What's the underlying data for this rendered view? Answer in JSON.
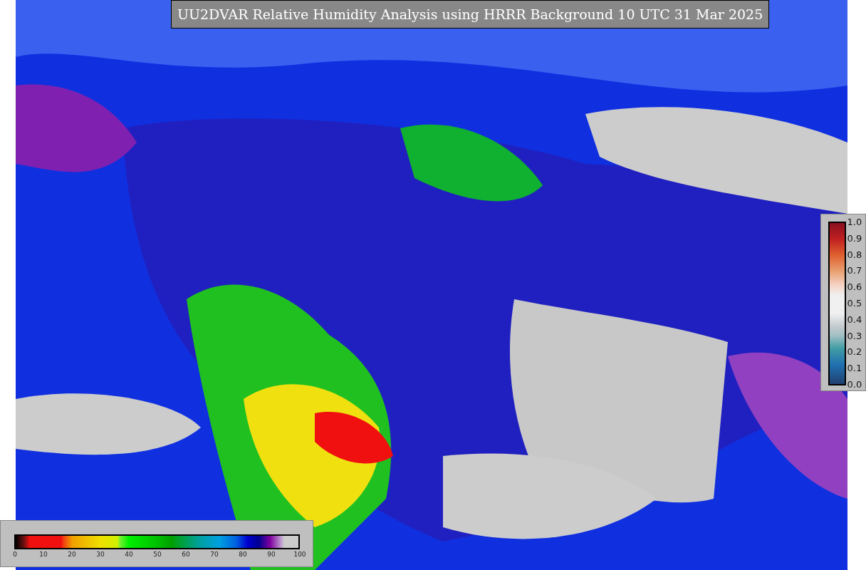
{
  "title": "UU2DVAR Relative Humidity Analysis using HRRR Background 10 UTC 31 Mar 2025",
  "legends": [
    {
      "kind": "horizontal",
      "ticks": [
        "0",
        "10",
        "20",
        "30",
        "40",
        "50",
        "60",
        "70",
        "80",
        "90",
        "100"
      ]
    },
    {
      "kind": "vertical",
      "ticks": [
        "1.0",
        "0.9",
        "0.8",
        "0.7",
        "0.6",
        "0.5",
        "0.4",
        "0.3",
        "0.2",
        "0.1",
        "0.0"
      ]
    }
  ]
}
